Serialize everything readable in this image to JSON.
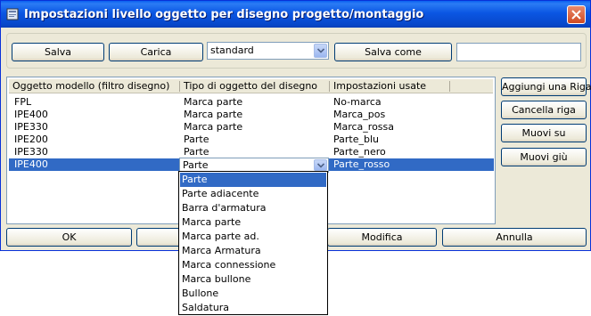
{
  "window": {
    "title": "Impostazioni livello oggetto per disegno progetto/montaggio"
  },
  "toolbar": {
    "save_label": "Salva",
    "load_label": "Carica",
    "preset_value": "standard",
    "save_as_label": "Salva come",
    "save_as_value": ""
  },
  "grid": {
    "columns": [
      "Oggetto modello (filtro disegno)",
      "Tipo di oggetto del disegno",
      "Impostazioni usate"
    ],
    "rows": [
      {
        "model": "FPL",
        "type": "Marca parte",
        "settings": "No-marca"
      },
      {
        "model": "IPE400",
        "type": "Marca parte",
        "settings": "Marca_pos"
      },
      {
        "model": "IPE330",
        "type": "Marca parte",
        "settings": "Marca_rossa"
      },
      {
        "model": "IPE200",
        "type": "Parte",
        "settings": "Parte_blu"
      },
      {
        "model": "IPE330",
        "type": "Parte",
        "settings": "Parte_nero"
      },
      {
        "model": "IPE400",
        "type": "Parte",
        "settings": "Parte_rosso"
      }
    ],
    "selected_index": 5
  },
  "side_buttons": {
    "add_row": "Aggiungi una Riga",
    "delete_row": "Cancella riga",
    "move_up": "Muovi su",
    "move_down": "Muovi giù"
  },
  "bottom_buttons": {
    "ok": "OK",
    "modify": "Modifica",
    "cancel": "Annulla"
  },
  "dropdown": {
    "options": [
      "Parte",
      "Parte adiacente",
      "Barra d'armatura",
      "Marca parte",
      "Marca parte ad.",
      "Marca Armatura",
      "Marca connessione",
      "Marca bullone",
      "Bullone",
      "Saldatura"
    ],
    "highlighted_index": 0
  },
  "colors": {
    "title_bar": "#0b56e3",
    "selection": "#316ac5",
    "dialog_bg": "#ece9d8",
    "close_button": "#d04a22"
  }
}
